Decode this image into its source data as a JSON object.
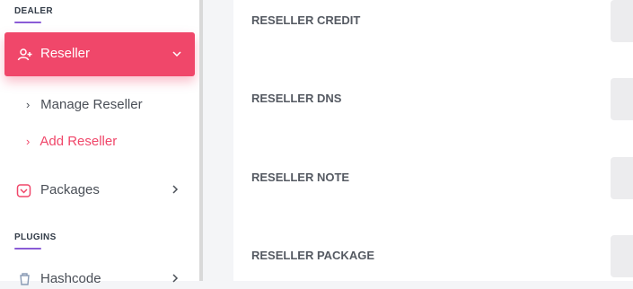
{
  "sidebar": {
    "dealer_heading": "DEALER",
    "reseller_label": "Reseller",
    "sub_items": [
      "Manage Reseller",
      "Add Reseller"
    ],
    "packages_label": "Packages",
    "plugins_heading": "PLUGINS",
    "hashcode_label": "Hashcode"
  },
  "content": {
    "rows": [
      "RESELLER CREDIT",
      "RESELLER DNS",
      "RESELLER NOTE",
      "RESELLER PACKAGE"
    ]
  },
  "colors": {
    "accent": "#f0476a",
    "heading_underline": "#8a5bd6"
  }
}
